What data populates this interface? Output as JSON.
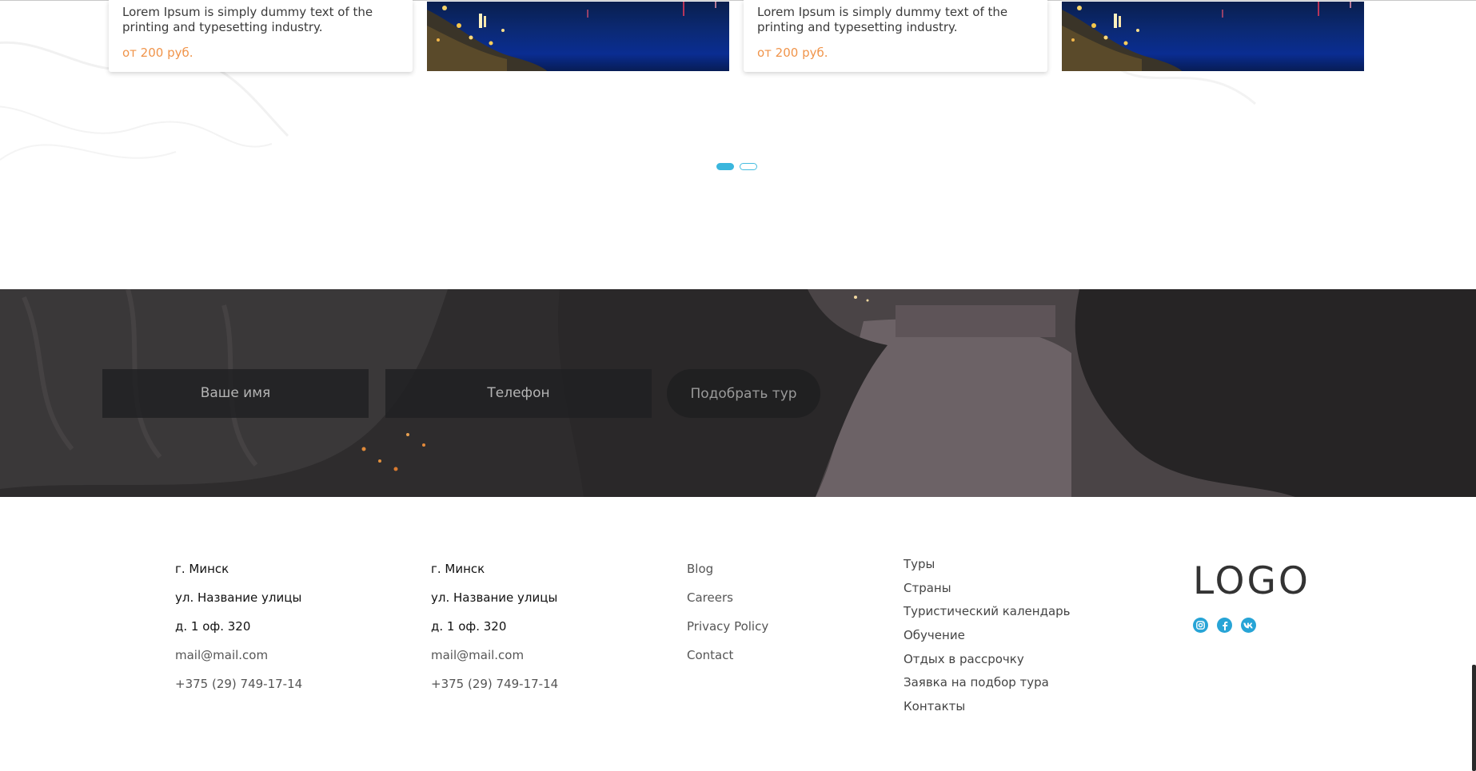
{
  "carousel": {
    "cards": [
      {
        "text": "Lorem Ipsum is simply dummy text of the printing and typesetting industry.",
        "price": "от 200 руб."
      },
      {
        "text": "Lorem Ipsum is simply dummy text of the printing and typesetting industry.",
        "price": "от 200 руб."
      }
    ],
    "pagination": {
      "pages": 2,
      "active": 1
    }
  },
  "form": {
    "name_placeholder": "Ваше имя",
    "phone_placeholder": "Телефон",
    "submit_label": "Подобрать тур"
  },
  "footer": {
    "office_1": {
      "city": "г. Минск",
      "street": "ул. Название улицы",
      "building": "д. 1 оф. 320",
      "email": "mail@mail.com",
      "phone": "+375 (29) 749-17-14"
    },
    "office_2": {
      "city": "г. Минск",
      "street": "ул. Название улицы",
      "building": "д. 1 оф. 320",
      "email": "mail@mail.com",
      "phone": "+375 (29) 749-17-14"
    },
    "links": [
      "Blog",
      "Careers",
      "Privacy Policy",
      "Contact"
    ],
    "menu": [
      "Туры",
      "Страны",
      "Туристический календарь",
      "Обучение",
      "Отдых в рассрочку",
      "Заявка на подбор тура",
      "Контакты"
    ],
    "logo": "LOGO",
    "socials": [
      {
        "icon": "instagram-icon"
      },
      {
        "icon": "facebook-icon"
      },
      {
        "icon": "vk-icon"
      }
    ]
  },
  "colors": {
    "accent_price": "#f0944a",
    "accent_social": "#27a4d6",
    "dot_active": "#3ab6dd"
  }
}
